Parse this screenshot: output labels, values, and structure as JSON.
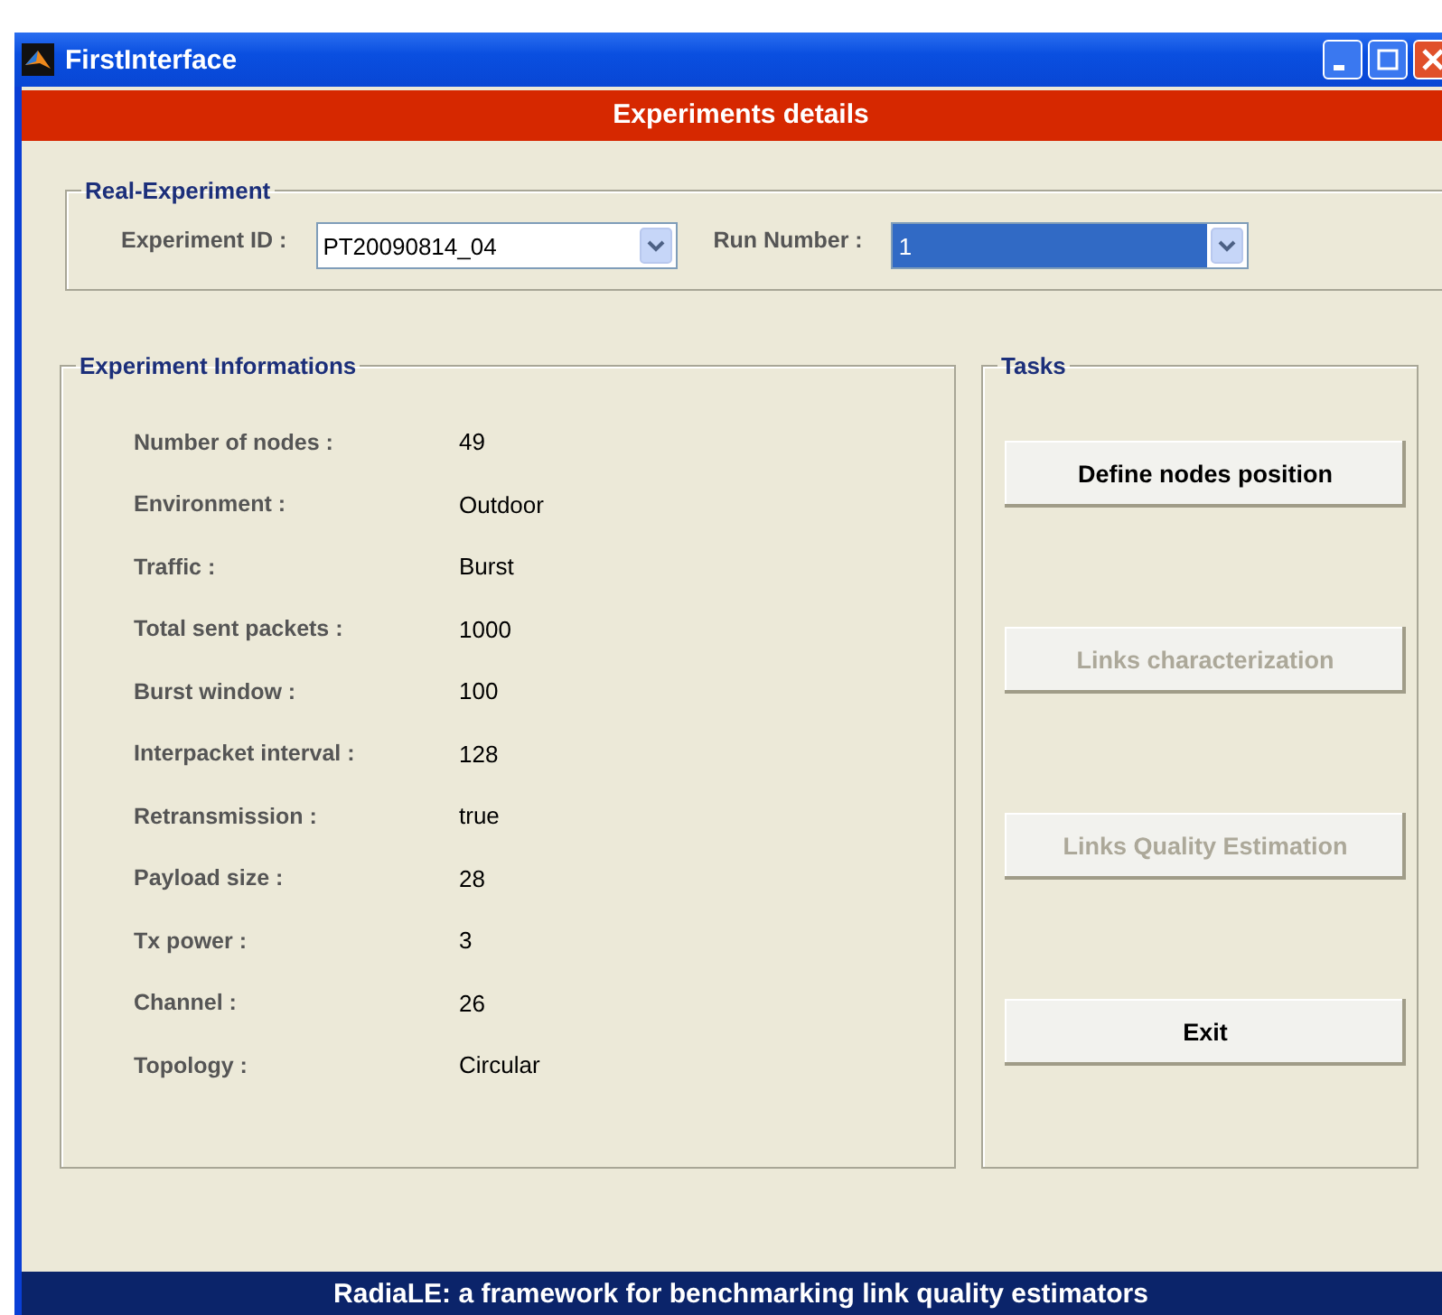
{
  "window": {
    "title": "FirstInterface"
  },
  "header": "Experiments details",
  "real_experiment": {
    "title": "Real-Experiment",
    "experiment_id": {
      "label": "Experiment ID :",
      "value": "PT20090814_04",
      "selected": false
    },
    "run_number": {
      "label": "Run Number :",
      "value": "1",
      "selected": true
    }
  },
  "experiment_informations": {
    "title": "Experiment Informations",
    "rows": [
      {
        "label": "Number of nodes :",
        "value": "49"
      },
      {
        "label": "Environment :",
        "value": "Outdoor"
      },
      {
        "label": "Traffic :",
        "value": "Burst"
      },
      {
        "label": "Total sent packets :",
        "value": "1000"
      },
      {
        "label": "Burst window :",
        "value": "100"
      },
      {
        "label": "Interpacket interval :",
        "value": "128"
      },
      {
        "label": "Retransmission :",
        "value": "true"
      },
      {
        "label": "Payload size :",
        "value": "28"
      },
      {
        "label": "Tx power :",
        "value": "3"
      },
      {
        "label": "Channel :",
        "value": "26"
      },
      {
        "label": "Topology :",
        "value": "Circular"
      }
    ]
  },
  "tasks": {
    "title": "Tasks",
    "buttons": [
      {
        "label": "Define nodes position",
        "disabled": false
      },
      {
        "label": "Links characterization",
        "disabled": true
      },
      {
        "label": "Links Quality Estimation",
        "disabled": true
      },
      {
        "label": "Exit",
        "disabled": false
      }
    ]
  },
  "footer": "RadiaLE: a framework for benchmarking link quality estimators"
}
